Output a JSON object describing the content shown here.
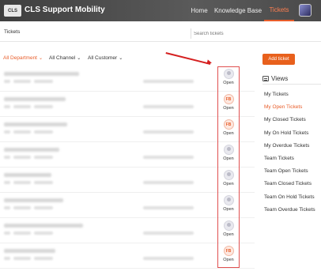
{
  "header": {
    "logo_text": "CLS",
    "app_title": "CLS Support Mobility",
    "nav": [
      {
        "label": "Home",
        "active": false
      },
      {
        "label": "Knowledge Base",
        "active": false
      },
      {
        "label": "Tickets",
        "active": true
      }
    ]
  },
  "subbar": {
    "breadcrumb": "Tickets",
    "search_placeholder": "Search tickets"
  },
  "filters": [
    {
      "label": "All Department",
      "active": true
    },
    {
      "label": "All Channel",
      "active": false
    },
    {
      "label": "All Customer",
      "active": false
    }
  ],
  "add_ticket_label": "Add ticket",
  "tickets": [
    {
      "status": "Open",
      "assignee_icon": "user-icon",
      "assignee_initials": ""
    },
    {
      "status": "Open",
      "assignee_icon": "initials-badge",
      "assignee_initials": "FB"
    },
    {
      "status": "Open",
      "assignee_icon": "initials-badge",
      "assignee_initials": "FB"
    },
    {
      "status": "Open",
      "assignee_icon": "user-icon",
      "assignee_initials": ""
    },
    {
      "status": "Open",
      "assignee_icon": "user-icon",
      "assignee_initials": ""
    },
    {
      "status": "Open",
      "assignee_icon": "user-icon",
      "assignee_initials": ""
    },
    {
      "status": "Open",
      "assignee_icon": "user-icon",
      "assignee_initials": ""
    },
    {
      "status": "Open",
      "assignee_icon": "initials-badge",
      "assignee_initials": "FB"
    }
  ],
  "views": {
    "title": "Views",
    "items": [
      {
        "label": "My Tickets",
        "active": false
      },
      {
        "label": "My Open Tickets",
        "active": true
      },
      {
        "label": "My Closed Tickets",
        "active": false
      },
      {
        "label": "My On Hold Tickets",
        "active": false
      },
      {
        "label": "My Overdue Tickets",
        "active": false
      },
      {
        "label": "Team Tickets",
        "active": false
      },
      {
        "label": "Team Open Tickets",
        "active": false
      },
      {
        "label": "Team Closed Tickets",
        "active": false
      },
      {
        "label": "Team On Hold Tickets",
        "active": false
      },
      {
        "label": "Team Overdue Tickets",
        "active": false
      }
    ]
  },
  "colors": {
    "accent": "#e85d2a",
    "header_bg": "#4a4a4a",
    "annotation": "#d52020"
  }
}
